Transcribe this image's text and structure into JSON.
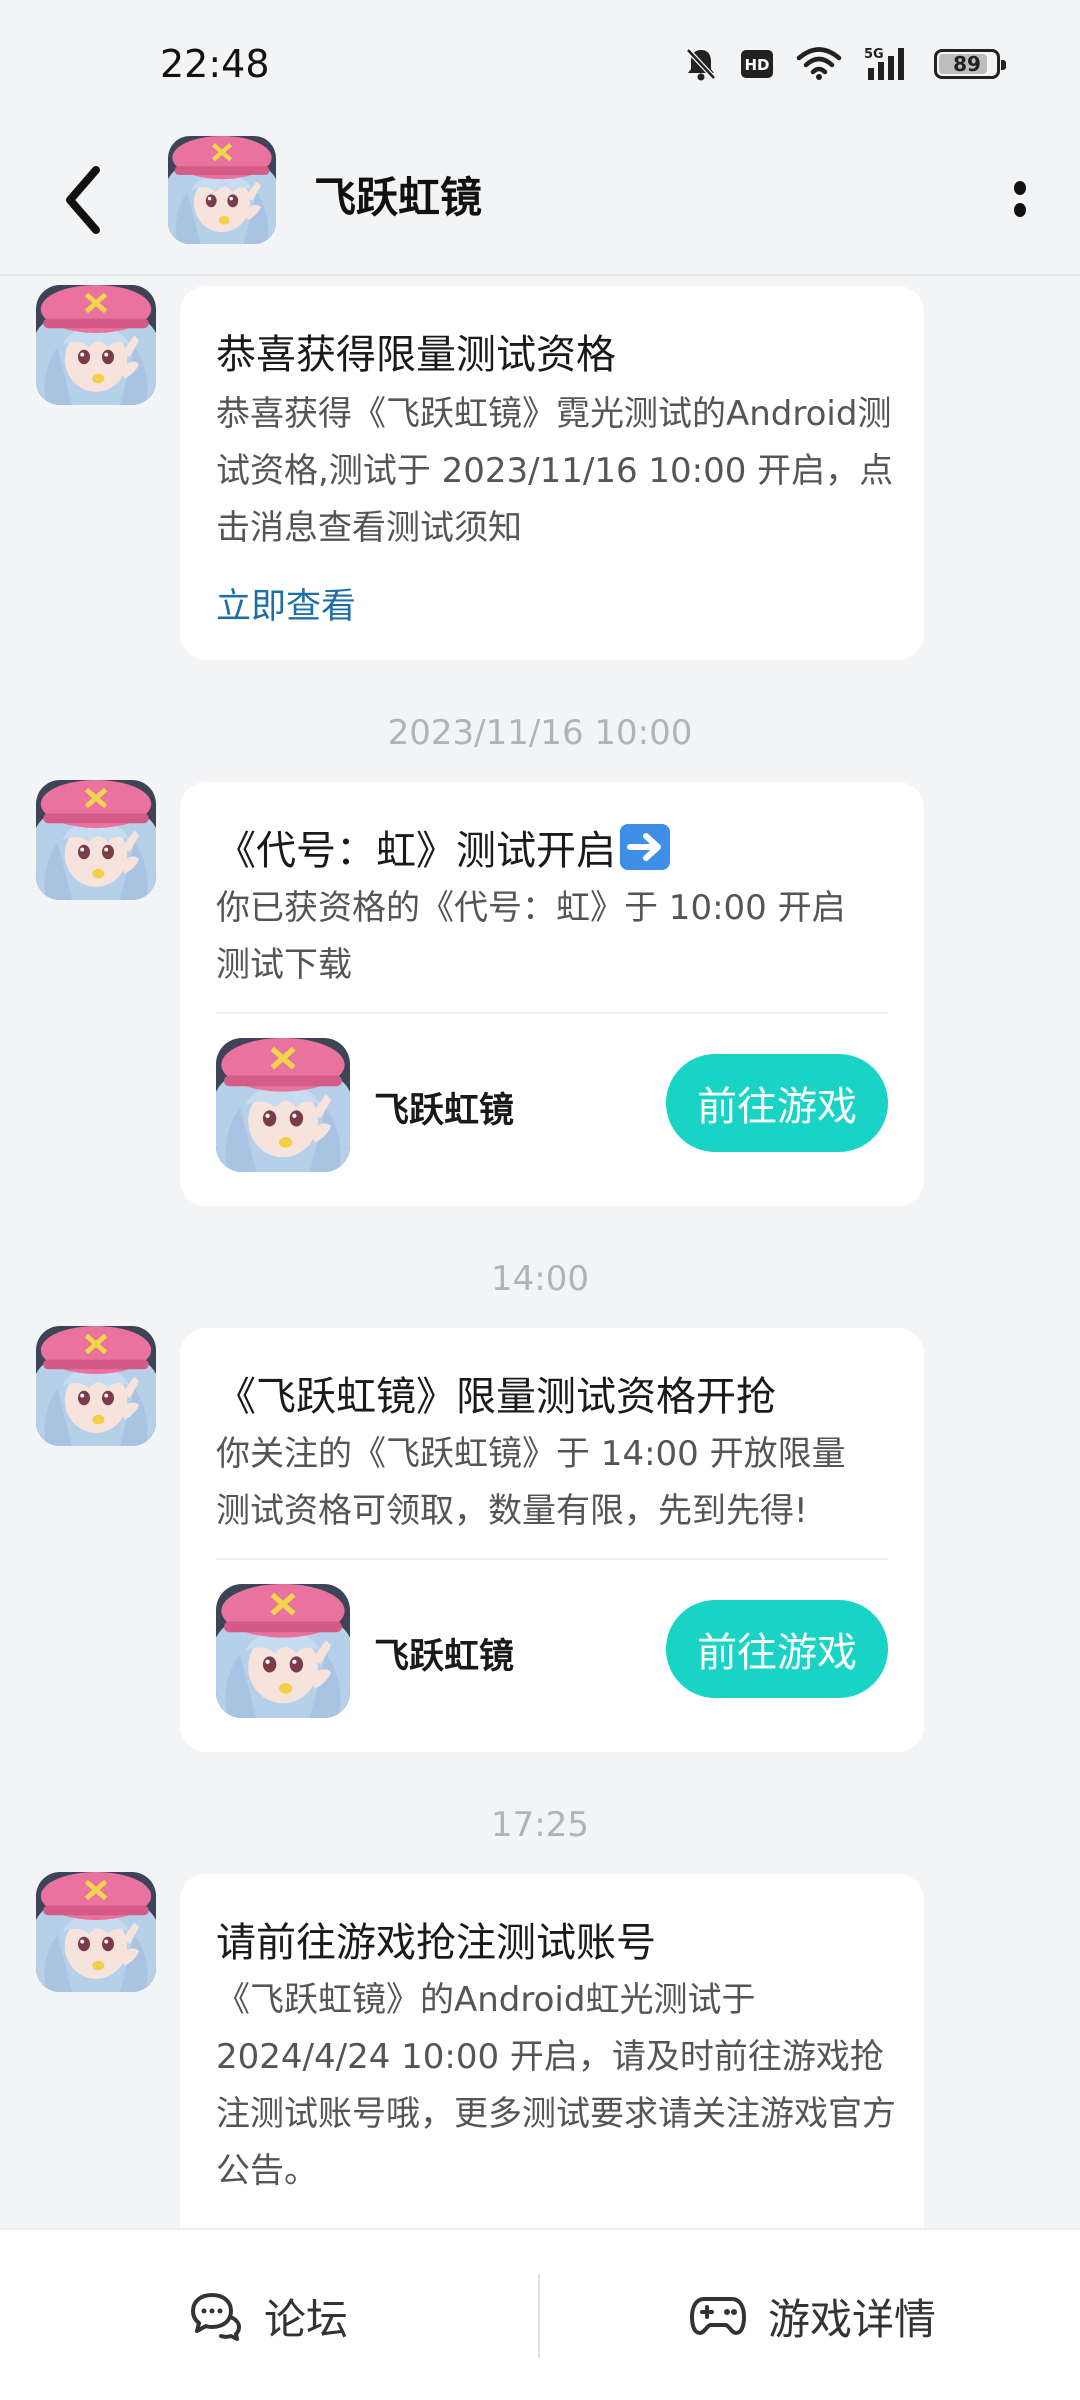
{
  "status_bar": {
    "time": "22:48",
    "icons": [
      "bell-muted-icon",
      "hd-icon",
      "wifi-icon",
      "signal-5g-icon"
    ],
    "battery": "89"
  },
  "header": {
    "title": "飞跃虹镜",
    "back_icon": "chevron-left-icon",
    "more_icon": "more-vertical-icon"
  },
  "messages": [
    {
      "title": "恭喜获得限量测试资格",
      "body": "恭喜获得《飞跃虹镜》霓光测试的Android测试资格,测试于 2023/11/16 10:00 开启，点击消息查看测试须知",
      "link": "立即查看"
    },
    {
      "timestamp": "2023/11/16  10:00",
      "title": "《代号：虹》测试开启",
      "title_emoji": "arrow-right-emoji-icon",
      "body": "你已获资格的《代号：虹》于 10:00 开启测试下载",
      "game_name": "飞跃虹镜",
      "button": "前往游戏"
    },
    {
      "timestamp": "14:00",
      "title": "《飞跃虹镜》限量测试资格开抢",
      "body": "你关注的《飞跃虹镜》于 14:00 开放限量测试资格可领取，数量有限，先到先得!",
      "game_name": "飞跃虹镜",
      "button": "前往游戏"
    },
    {
      "timestamp": "17:25",
      "title": "请前往游戏抢注测试账号",
      "body": "《飞跃虹镜》的Android虹光测试于2024/4/24 10:00 开启，请及时前往游戏抢注测试账号哦，更多测试要求请关注游戏官方公告。"
    }
  ],
  "bottom_bar": {
    "forum_label": "论坛",
    "forum_icon": "chat-bubbles-icon",
    "details_label": "游戏详情",
    "details_icon": "gamepad-icon"
  },
  "colors": {
    "accent": "#19d3c5",
    "link": "#1d6fa5",
    "background": "#f3f4f6"
  }
}
